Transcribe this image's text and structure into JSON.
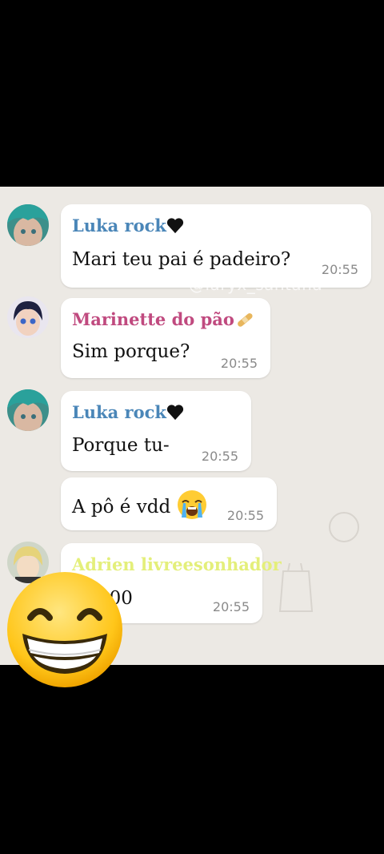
{
  "messages": [
    {
      "sender": "Luka rock",
      "sender_color": "#4a86b8",
      "text": "Mari teu pai é padeiro?",
      "time": "20:55",
      "sender_emoji": "black-heart-icon"
    },
    {
      "sender": "Marinette do pão",
      "sender_color": "#c04a7f",
      "text": "Sim porque?",
      "time": "20:55",
      "sender_emoji": "bandage-icon"
    },
    {
      "sender": "Luka rock",
      "sender_color": "#4a86b8",
      "text": "Porque tu-",
      "time": "20:55",
      "sender_emoji": "black-heart-icon"
    },
    {
      "text": "A pô é vdd",
      "time": "20:55",
      "text_emoji": "loudly-crying-face-icon"
    },
    {
      "sender": "Adrien livreesonhador",
      "sender_color": "#e4ef7a",
      "text": "R0000",
      "time": "20:55"
    }
  ],
  "watermark": "@laryx_santana",
  "overlay_emoji": "grinning-face-icon",
  "colors": {
    "chat_bg": "#ece9e4",
    "bubble": "#ffffff",
    "frame": "#000000"
  }
}
